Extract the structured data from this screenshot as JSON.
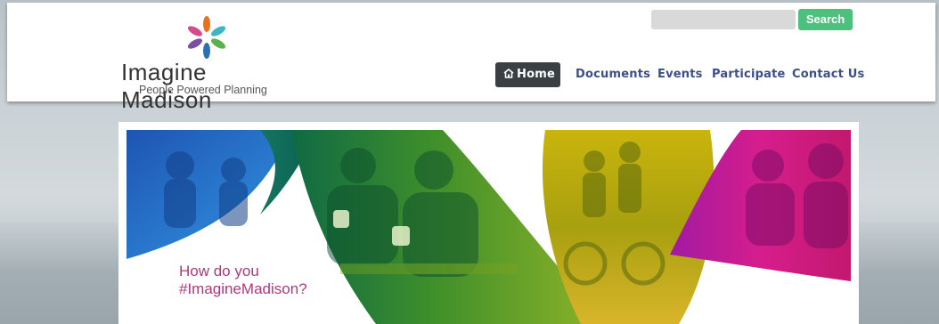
{
  "header": {
    "logo": {
      "name": "Imagine Madison",
      "tagline": "People Powered Planning",
      "colors": [
        "#e8701f",
        "#3db6c5",
        "#7a4fa0",
        "#5bb14a",
        "#2b6fb6",
        "#d64a8c"
      ]
    },
    "search": {
      "value": "",
      "placeholder": "",
      "button_label": "Search",
      "button_color": "#4cc07c"
    },
    "nav": {
      "items": [
        {
          "label": "Home",
          "icon": "home-icon",
          "active": true
        },
        {
          "label": "Documents"
        },
        {
          "label": "Events"
        },
        {
          "label": "Participate"
        },
        {
          "label": "Contact Us"
        }
      ],
      "link_color": "#3c4e8c",
      "active_bg": "#3a3f44"
    }
  },
  "banner": {
    "line1": "How do you",
    "line2": "#ImagineMadison?",
    "text_color": "#b0377c"
  }
}
